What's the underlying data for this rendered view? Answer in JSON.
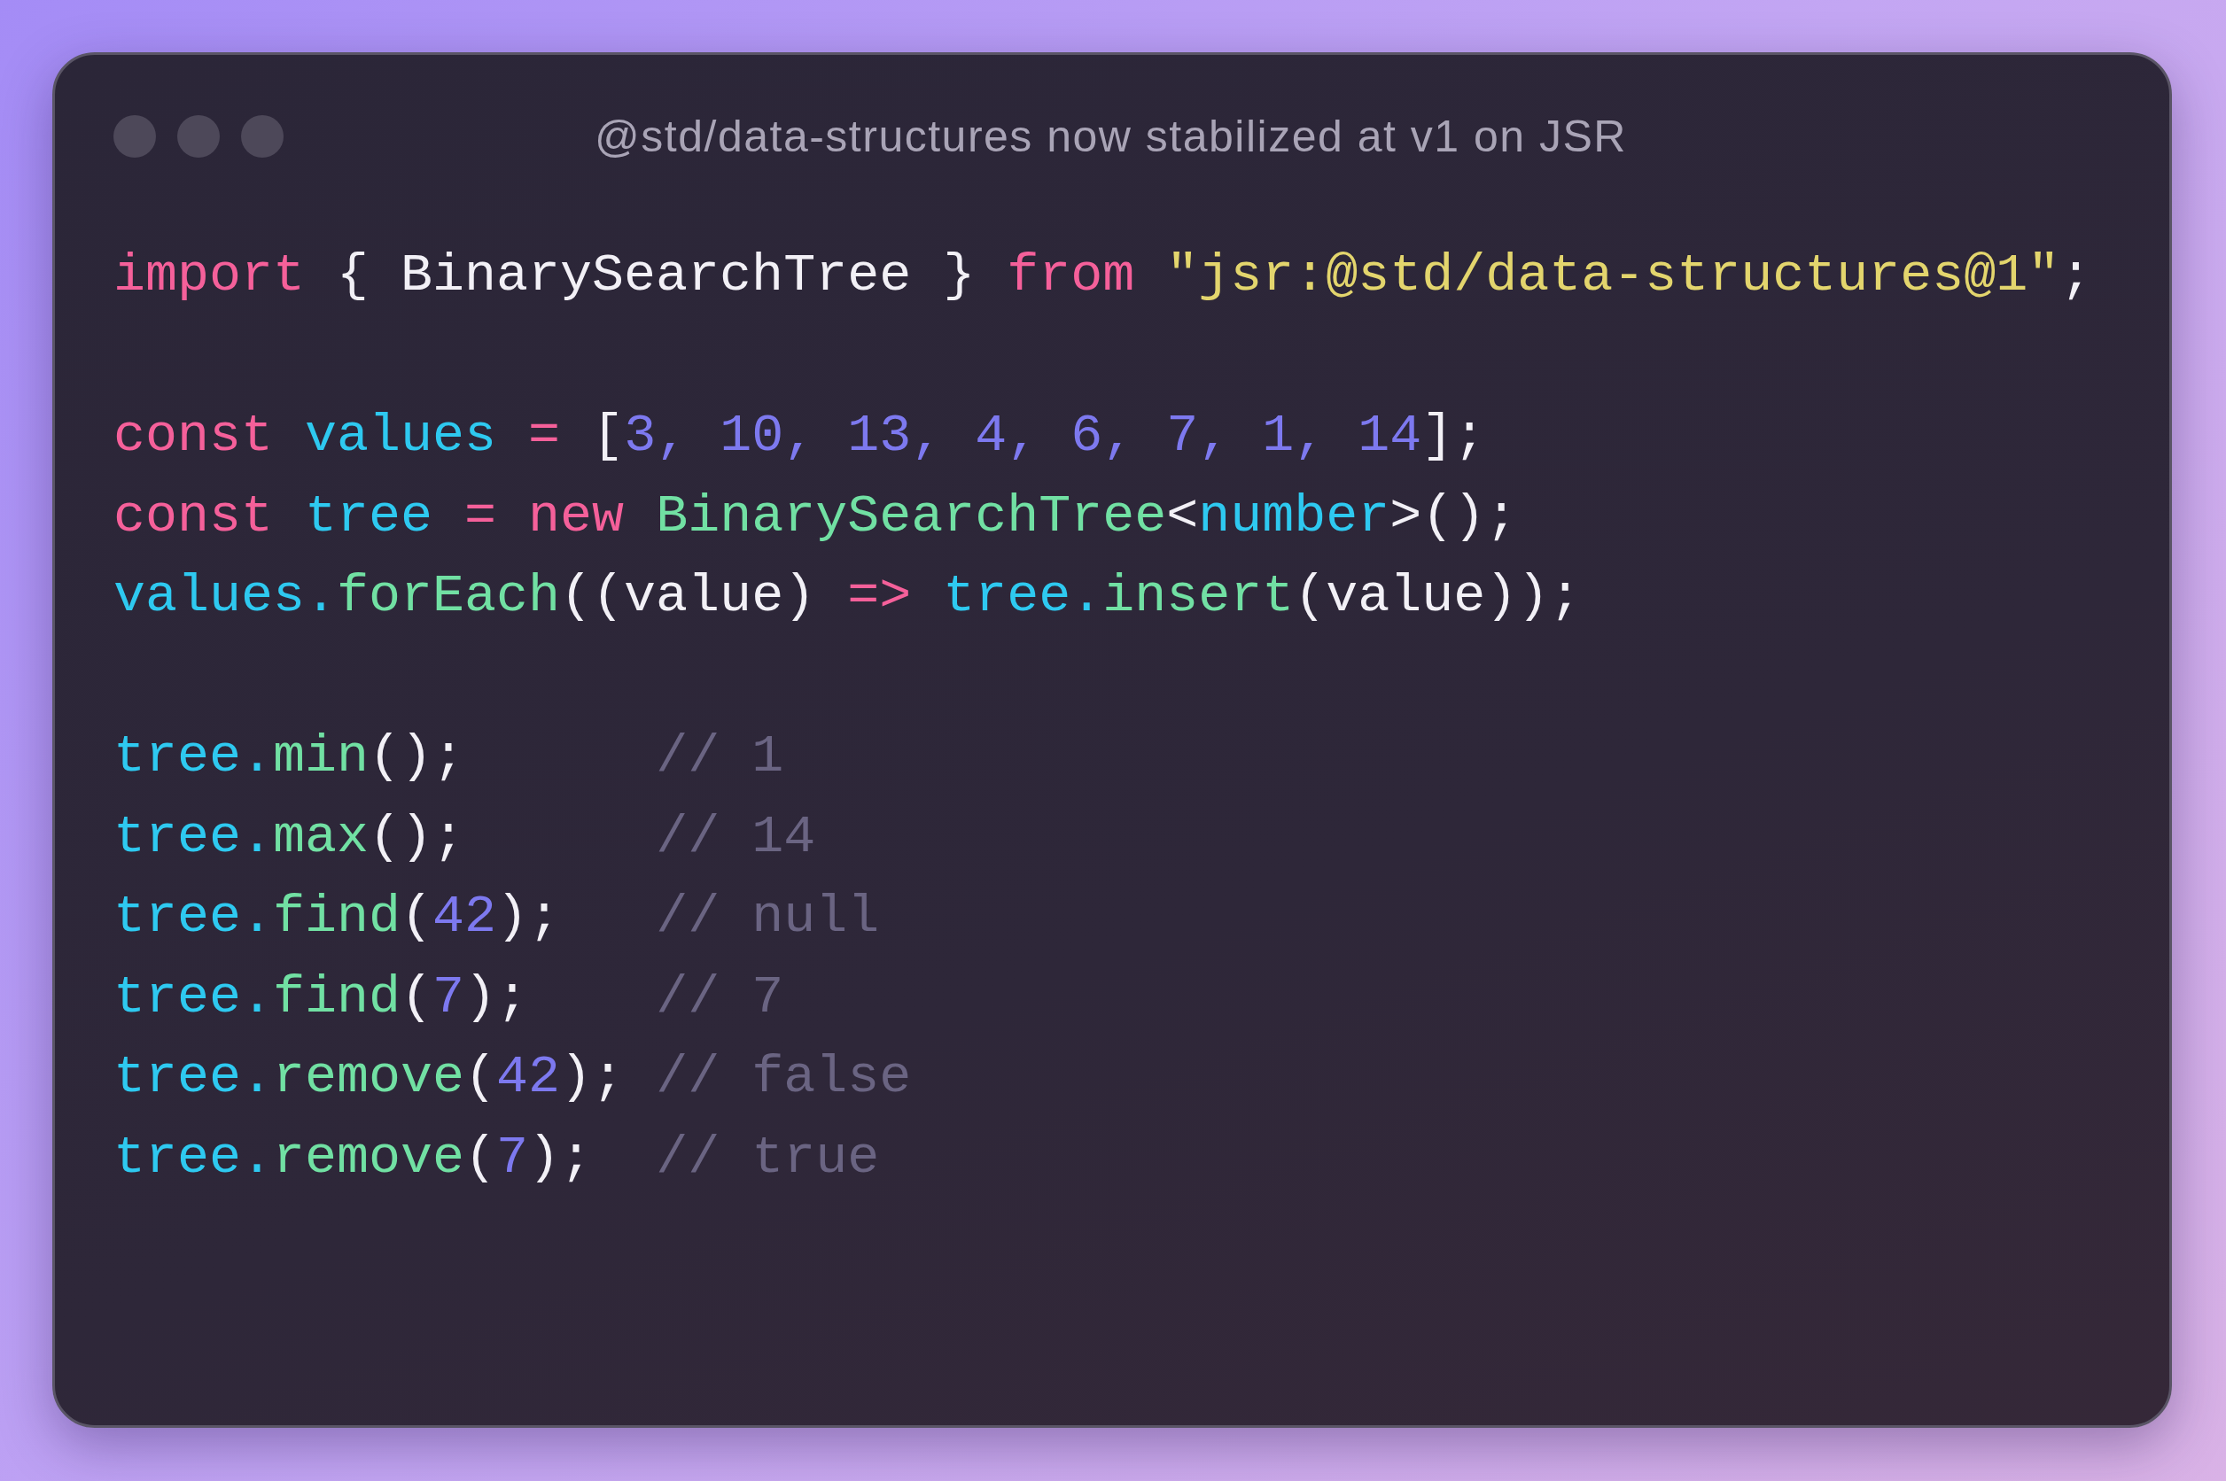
{
  "window": {
    "title": "@std/data-structures now stabilized at v1 on JSR"
  },
  "lines": [
    {
      "kind": "code",
      "tokens": [
        {
          "text": "import ",
          "kind": "keyword"
        },
        {
          "text": "{ BinarySearchTree } ",
          "kind": "plain"
        },
        {
          "text": "from ",
          "kind": "keyword"
        },
        {
          "text": "\"jsr:@std/data-structures@1\"",
          "kind": "string"
        },
        {
          "text": ";",
          "kind": "plain"
        }
      ]
    },
    {
      "kind": "blank"
    },
    {
      "kind": "code",
      "tokens": [
        {
          "text": "const ",
          "kind": "keyword"
        },
        {
          "text": "values ",
          "kind": "identifier"
        },
        {
          "text": "= ",
          "kind": "keyword"
        },
        {
          "text": "[",
          "kind": "plain"
        },
        {
          "text": "3, 10, 13, 4, 6, 7, 1, 14",
          "kind": "number"
        },
        {
          "text": "];",
          "kind": "plain"
        }
      ]
    },
    {
      "kind": "code",
      "tokens": [
        {
          "text": "const ",
          "kind": "keyword"
        },
        {
          "text": "tree ",
          "kind": "identifier"
        },
        {
          "text": "= new ",
          "kind": "keyword"
        },
        {
          "text": "BinarySearchTree",
          "kind": "function"
        },
        {
          "text": "<",
          "kind": "plain"
        },
        {
          "text": "number",
          "kind": "identifier"
        },
        {
          "text": ">();",
          "kind": "plain"
        }
      ]
    },
    {
      "kind": "code",
      "tokens": [
        {
          "text": "values.",
          "kind": "identifier"
        },
        {
          "text": "forEach",
          "kind": "function"
        },
        {
          "text": "((value) ",
          "kind": "plain"
        },
        {
          "text": "=> ",
          "kind": "keyword"
        },
        {
          "text": "tree.",
          "kind": "identifier"
        },
        {
          "text": "insert",
          "kind": "function"
        },
        {
          "text": "(value));",
          "kind": "plain"
        }
      ]
    },
    {
      "kind": "blank"
    },
    {
      "kind": "code",
      "tokens": [
        {
          "text": "tree.",
          "kind": "identifier"
        },
        {
          "text": "min",
          "kind": "function"
        },
        {
          "text": "();      ",
          "kind": "plain"
        },
        {
          "text": "// 1",
          "kind": "comment"
        }
      ]
    },
    {
      "kind": "code",
      "tokens": [
        {
          "text": "tree.",
          "kind": "identifier"
        },
        {
          "text": "max",
          "kind": "function"
        },
        {
          "text": "();      ",
          "kind": "plain"
        },
        {
          "text": "// 14",
          "kind": "comment"
        }
      ]
    },
    {
      "kind": "code",
      "tokens": [
        {
          "text": "tree.",
          "kind": "identifier"
        },
        {
          "text": "find",
          "kind": "function"
        },
        {
          "text": "(",
          "kind": "plain"
        },
        {
          "text": "42",
          "kind": "number"
        },
        {
          "text": ");   ",
          "kind": "plain"
        },
        {
          "text": "// null",
          "kind": "comment"
        }
      ]
    },
    {
      "kind": "code",
      "tokens": [
        {
          "text": "tree.",
          "kind": "identifier"
        },
        {
          "text": "find",
          "kind": "function"
        },
        {
          "text": "(",
          "kind": "plain"
        },
        {
          "text": "7",
          "kind": "number"
        },
        {
          "text": ");    ",
          "kind": "plain"
        },
        {
          "text": "// 7",
          "kind": "comment"
        }
      ]
    },
    {
      "kind": "code",
      "tokens": [
        {
          "text": "tree.",
          "kind": "identifier"
        },
        {
          "text": "remove",
          "kind": "function"
        },
        {
          "text": "(",
          "kind": "plain"
        },
        {
          "text": "42",
          "kind": "number"
        },
        {
          "text": "); ",
          "kind": "plain"
        },
        {
          "text": "// false",
          "kind": "comment"
        }
      ]
    },
    {
      "kind": "code",
      "tokens": [
        {
          "text": "tree.",
          "kind": "identifier"
        },
        {
          "text": "remove",
          "kind": "function"
        },
        {
          "text": "(",
          "kind": "plain"
        },
        {
          "text": "7",
          "kind": "number"
        },
        {
          "text": ");  ",
          "kind": "plain"
        },
        {
          "text": "// true",
          "kind": "comment"
        }
      ]
    }
  ]
}
